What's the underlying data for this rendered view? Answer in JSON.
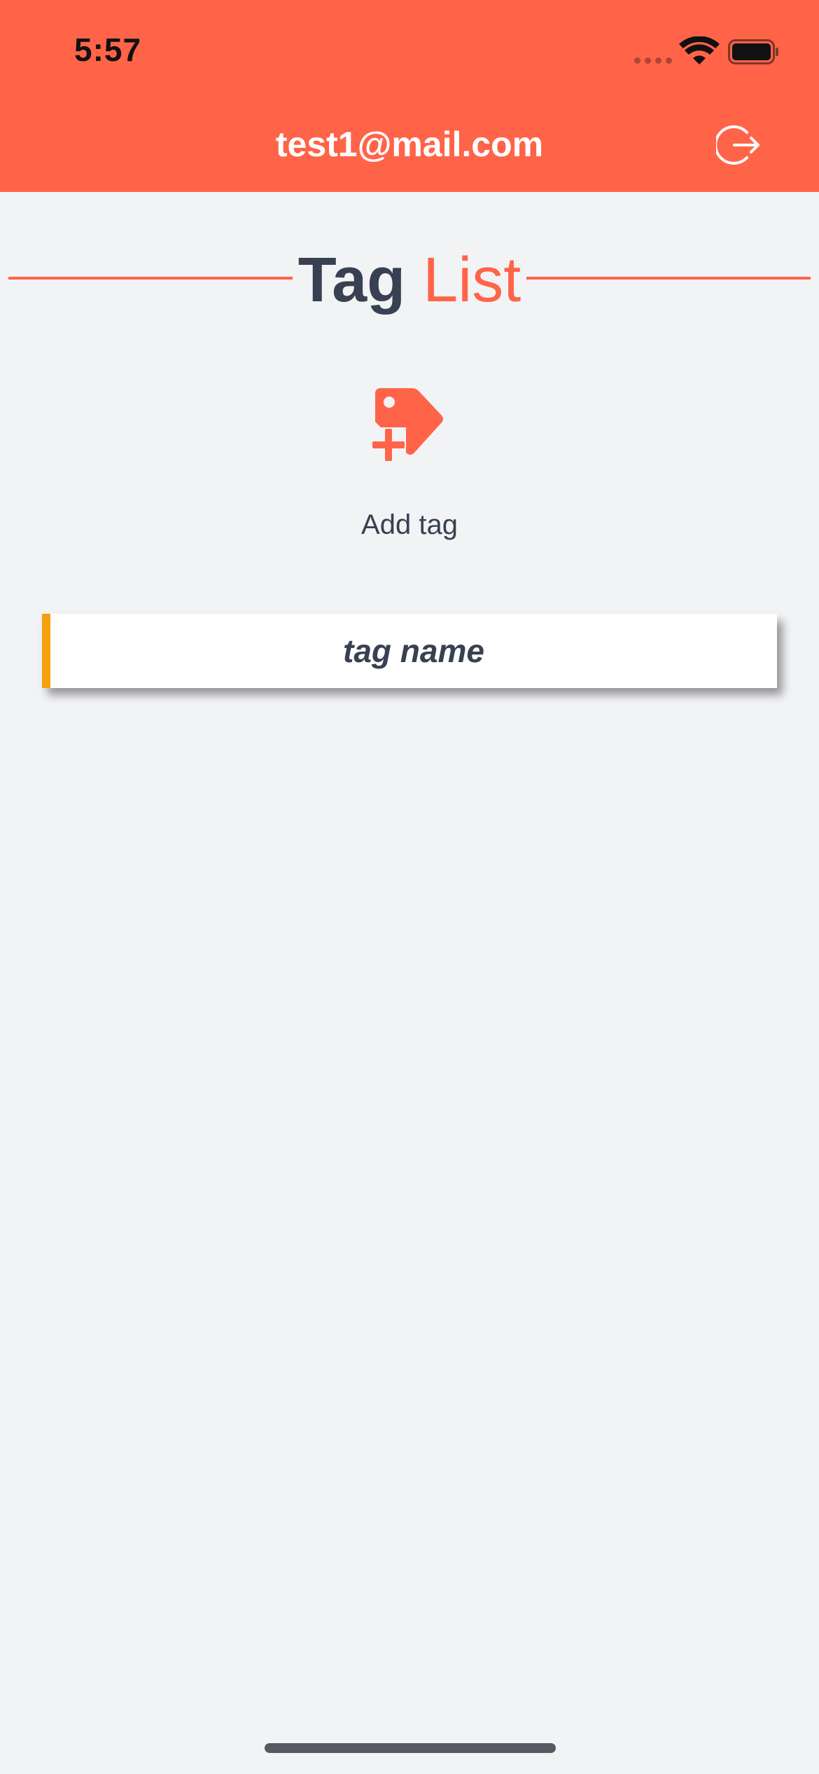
{
  "status_bar": {
    "time": "5:57"
  },
  "header": {
    "email": "test1@mail.com",
    "logout_icon": "logout-icon"
  },
  "title": {
    "strong": "Tag",
    "light": "List"
  },
  "add_tag": {
    "icon": "tag-plus-icon",
    "label": "Add tag"
  },
  "tags": [
    {
      "label": "tag name",
      "accent": "#f5a00f"
    }
  ],
  "colors": {
    "brand": "#ff6449",
    "text": "#374151",
    "background": "#f2f3f5"
  }
}
